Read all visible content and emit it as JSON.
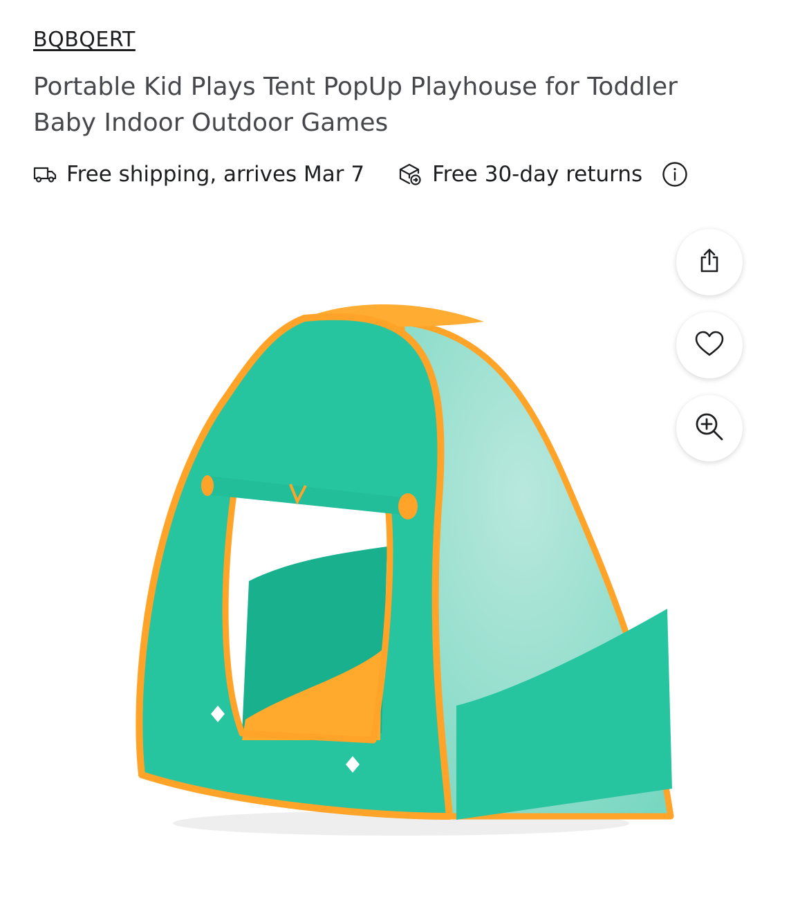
{
  "brand": "BQBQERT",
  "product": {
    "title": "Portable Kid Plays Tent PopUp Playhouse for Toddler Baby Indoor Outdoor Games"
  },
  "perks": [
    {
      "icon": "truck-icon",
      "label": "Free shipping, arrives Mar 7"
    },
    {
      "icon": "return-box-icon",
      "label": "Free 30-day returns"
    }
  ],
  "info_icon": "info-icon",
  "actions": [
    {
      "icon": "share-icon"
    },
    {
      "icon": "heart-icon"
    },
    {
      "icon": "zoom-in-icon"
    }
  ],
  "colors": {
    "tent_teal": "#1fc39c",
    "tent_orange": "#ffad33",
    "text_dark": "#1c1d1f",
    "text_title": "#46474a"
  }
}
